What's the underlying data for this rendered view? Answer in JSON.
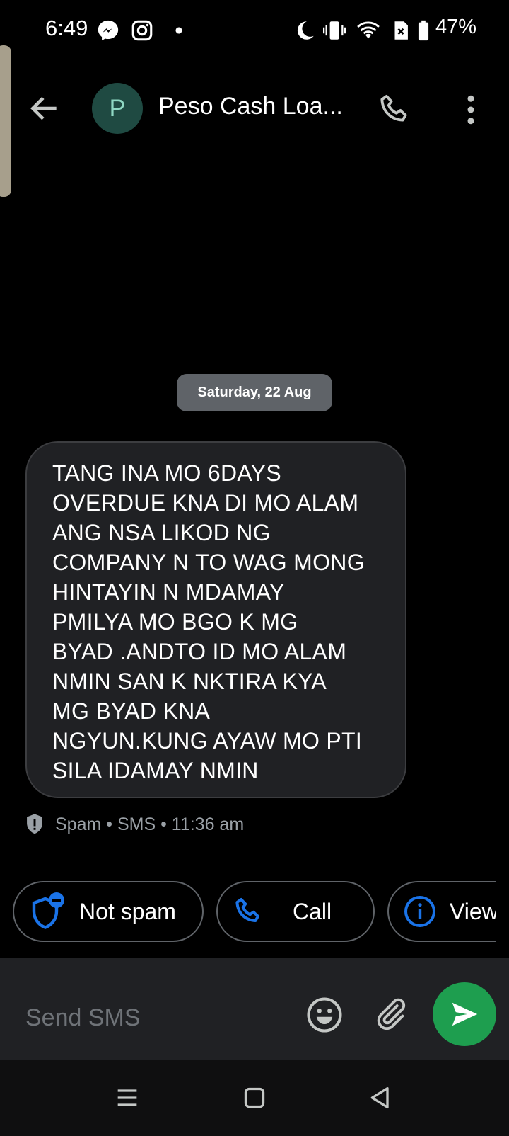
{
  "status_bar": {
    "time": "6:49",
    "battery_percent": "47%",
    "icons": [
      "messenger-icon",
      "instagram-icon",
      "dot-icon",
      "moon-icon",
      "vibrate-icon",
      "wifi-icon",
      "no-sim-icon",
      "battery-icon"
    ]
  },
  "header": {
    "avatar_letter": "P",
    "title": "Peso Cash Loa..."
  },
  "conversation": {
    "date_chip": "Saturday, 22 Aug",
    "message": {
      "lines": [
        "TANG INA MO 6DAYS",
        "OVERDUE KNA DI MO ALAM",
        "ANG NSA LIKOD NG",
        "COMPANY N TO WAG MONG",
        "HINTAYIN N MDAMAY",
        "PMILYA MO BGO K MG",
        "BYAD .ANDTO ID MO ALAM",
        "NMIN SAN K NKTIRA KYA",
        "MG BYAD KNA",
        "NGYUN.KUNG AYAW MO PTI",
        "SILA IDAMAY NMIN"
      ],
      "meta": "Spam • SMS • 11:36 am"
    }
  },
  "suggestions": {
    "not_spam": "Not spam",
    "call": "Call",
    "view": "View"
  },
  "compose": {
    "placeholder": "Send SMS"
  },
  "colors": {
    "background": "#000000",
    "bubble": "#202124",
    "accent_blue": "#1a73e8",
    "send_green": "#1e9e4f",
    "date_chip": "#5f6368"
  }
}
